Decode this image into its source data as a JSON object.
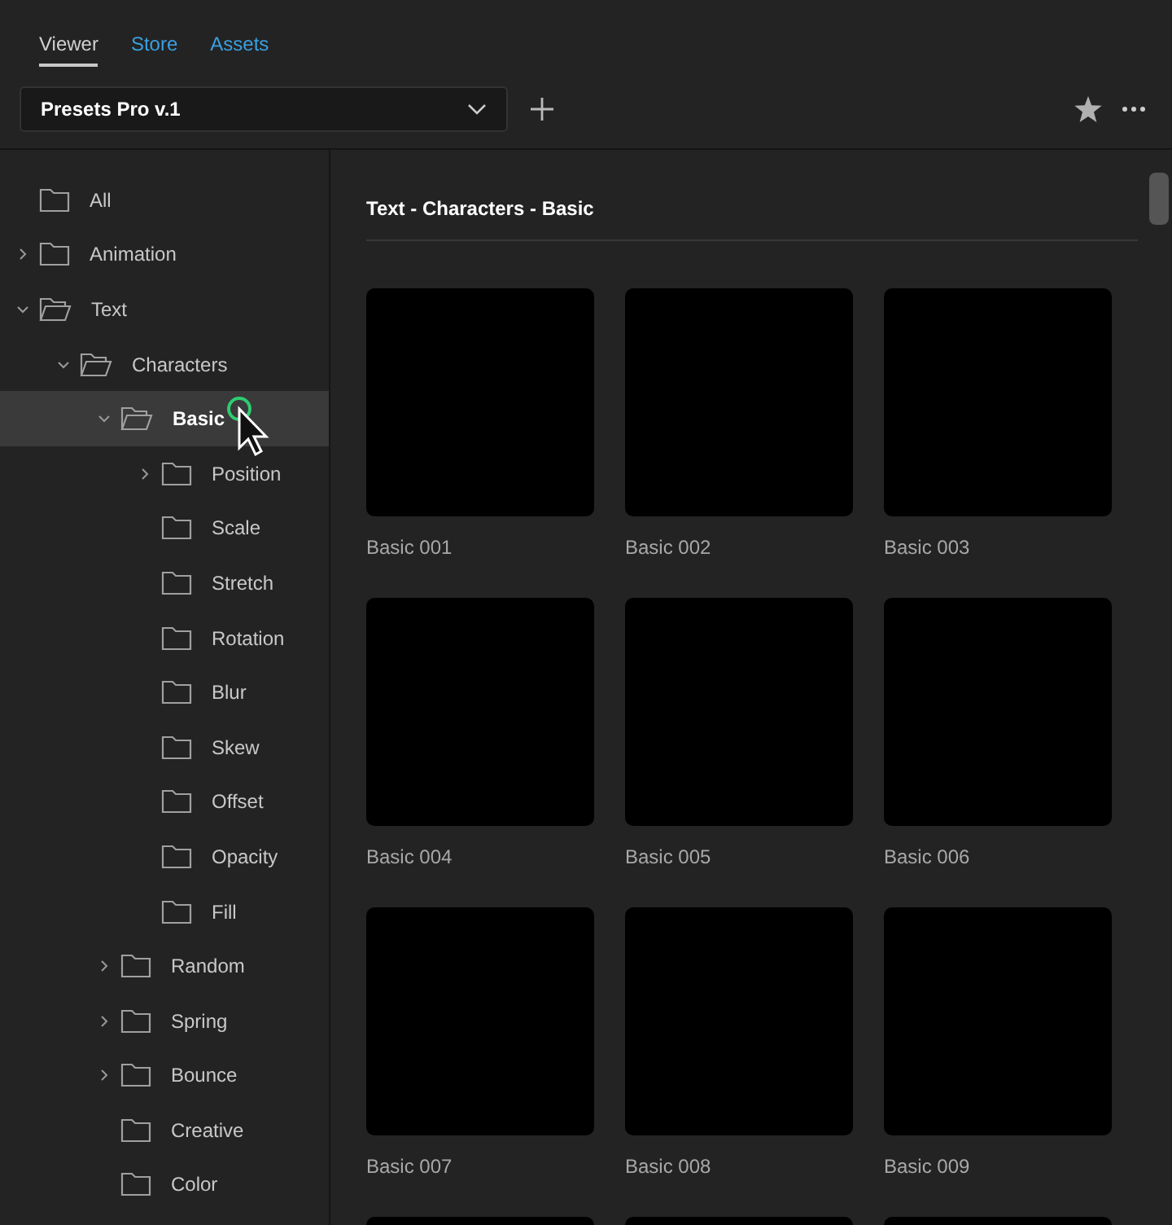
{
  "tabs": [
    {
      "label": "Viewer",
      "selected": true
    },
    {
      "label": "Store",
      "selected": false
    },
    {
      "label": "Assets",
      "selected": false
    }
  ],
  "preset_select": {
    "value": "Presets Pro v.1"
  },
  "tree": [
    {
      "label": "All",
      "kind": "leaf",
      "selected": false
    },
    {
      "label": "Animation",
      "kind": "branch",
      "expanded": false,
      "selected": false
    },
    {
      "label": "Text",
      "kind": "branch",
      "expanded": true,
      "selected": false,
      "children": [
        {
          "label": "Characters",
          "kind": "branch",
          "expanded": true,
          "selected": false,
          "children": [
            {
              "label": "Basic",
              "kind": "branch",
              "expanded": true,
              "selected": true,
              "children": [
                {
                  "label": "Position",
                  "kind": "branch",
                  "expanded": false,
                  "selected": false
                },
                {
                  "label": "Scale",
                  "kind": "leaf",
                  "selected": false
                },
                {
                  "label": "Stretch",
                  "kind": "leaf",
                  "selected": false
                },
                {
                  "label": "Rotation",
                  "kind": "leaf",
                  "selected": false
                },
                {
                  "label": "Blur",
                  "kind": "leaf",
                  "selected": false
                },
                {
                  "label": "Skew",
                  "kind": "leaf",
                  "selected": false
                },
                {
                  "label": "Offset",
                  "kind": "leaf",
                  "selected": false
                },
                {
                  "label": "Opacity",
                  "kind": "leaf",
                  "selected": false
                },
                {
                  "label": "Fill",
                  "kind": "leaf",
                  "selected": false
                }
              ]
            },
            {
              "label": "Random",
              "kind": "branch",
              "expanded": false,
              "selected": false
            },
            {
              "label": "Spring",
              "kind": "branch",
              "expanded": false,
              "selected": false
            },
            {
              "label": "Bounce",
              "kind": "branch",
              "expanded": false,
              "selected": false
            },
            {
              "label": "Creative",
              "kind": "leaf",
              "selected": false
            },
            {
              "label": "Color",
              "kind": "leaf",
              "selected": false
            }
          ]
        }
      ]
    }
  ],
  "breadcrumb": "Text - Characters - Basic",
  "presets": [
    {
      "kind": "preset",
      "name": "Basic 001"
    },
    {
      "kind": "preset",
      "name": "Basic 002"
    },
    {
      "kind": "preset",
      "name": "Basic 003"
    },
    {
      "kind": "preset",
      "name": "Basic 004"
    },
    {
      "kind": "preset",
      "name": "Basic 005"
    },
    {
      "kind": "preset",
      "name": "Basic 006"
    },
    {
      "kind": "preset",
      "name": "Basic 007"
    },
    {
      "kind": "preset",
      "name": "Basic 008"
    },
    {
      "kind": "preset",
      "name": "Basic 009"
    },
    {
      "kind": "thumbnail_only"
    },
    {
      "kind": "thumbnail_only"
    },
    {
      "kind": "thumbnail_only"
    }
  ]
}
